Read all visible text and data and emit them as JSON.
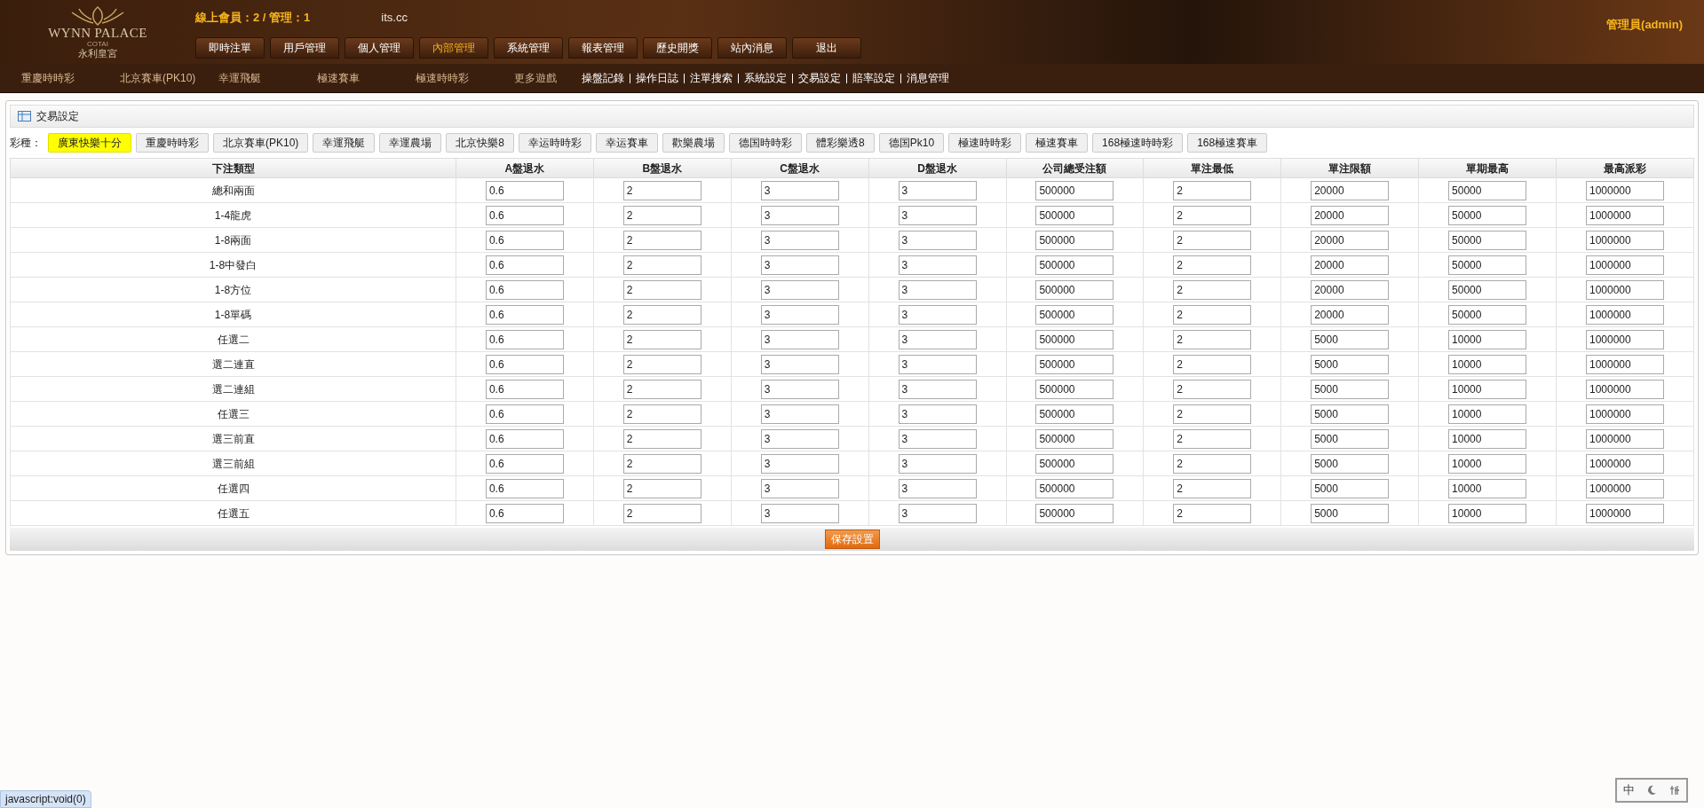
{
  "logo": {
    "name": "WYNN PALACE",
    "sub": "COTAI",
    "chinese": "永利皇宮"
  },
  "online": "線上會員：2 / 管理：1",
  "site": "its.cc",
  "user": "管理員(admin)",
  "menu": [
    {
      "label": "即時注單",
      "selected": false
    },
    {
      "label": "用戶管理",
      "selected": false
    },
    {
      "label": "個人管理",
      "selected": false
    },
    {
      "label": "內部管理",
      "selected": true
    },
    {
      "label": "系統管理",
      "selected": false
    },
    {
      "label": "報表管理",
      "selected": false
    },
    {
      "label": "歷史開獎",
      "selected": false
    },
    {
      "label": "站內消息",
      "selected": false
    },
    {
      "label": "退出",
      "selected": false
    }
  ],
  "games": [
    "重慶時時彩",
    "北京賽車(PK10)",
    "幸運飛艇",
    "極速賽車",
    "極速時時彩",
    "更多遊戲"
  ],
  "links": [
    "操盤記錄",
    "操作日誌",
    "注單搜索",
    "系統設定",
    "交易設定",
    "賠率設定",
    "消息管理"
  ],
  "panel_title": "交易設定",
  "lottery_label": "彩種：",
  "lottery_tabs": [
    {
      "label": "廣東快樂十分",
      "selected": true
    },
    {
      "label": "重慶時時彩",
      "selected": false
    },
    {
      "label": "北京賽車(PK10)",
      "selected": false
    },
    {
      "label": "幸運飛艇",
      "selected": false
    },
    {
      "label": "幸運農場",
      "selected": false
    },
    {
      "label": "北京快樂8",
      "selected": false
    },
    {
      "label": "幸运時時彩",
      "selected": false
    },
    {
      "label": "幸运賽車",
      "selected": false
    },
    {
      "label": "歡樂農場",
      "selected": false
    },
    {
      "label": "德国時時彩",
      "selected": false
    },
    {
      "label": "體彩樂透8",
      "selected": false
    },
    {
      "label": "德国Pk10",
      "selected": false
    },
    {
      "label": "極速時時彩",
      "selected": false
    },
    {
      "label": "極速賽車",
      "selected": false
    },
    {
      "label": "168極速時時彩",
      "selected": false
    },
    {
      "label": "168極速賽車",
      "selected": false
    }
  ],
  "table": {
    "columns": [
      "下注類型",
      "A盤退水",
      "B盤退水",
      "C盤退水",
      "D盤退水",
      "公司總受注額",
      "單注最低",
      "單注限額",
      "單期最高",
      "最高派彩"
    ],
    "rows": [
      {
        "type": "總和兩面",
        "values": [
          "0.6",
          "2",
          "3",
          "3",
          "500000",
          "2",
          "20000",
          "50000",
          "1000000"
        ]
      },
      {
        "type": "1-4龍虎",
        "values": [
          "0.6",
          "2",
          "3",
          "3",
          "500000",
          "2",
          "20000",
          "50000",
          "1000000"
        ]
      },
      {
        "type": "1-8兩面",
        "values": [
          "0.6",
          "2",
          "3",
          "3",
          "500000",
          "2",
          "20000",
          "50000",
          "1000000"
        ]
      },
      {
        "type": "1-8中發白",
        "values": [
          "0.6",
          "2",
          "3",
          "3",
          "500000",
          "2",
          "20000",
          "50000",
          "1000000"
        ]
      },
      {
        "type": "1-8方位",
        "values": [
          "0.6",
          "2",
          "3",
          "3",
          "500000",
          "2",
          "20000",
          "50000",
          "1000000"
        ]
      },
      {
        "type": "1-8單碼",
        "values": [
          "0.6",
          "2",
          "3",
          "3",
          "500000",
          "2",
          "20000",
          "50000",
          "1000000"
        ]
      },
      {
        "type": "任選二",
        "values": [
          "0.6",
          "2",
          "3",
          "3",
          "500000",
          "2",
          "5000",
          "10000",
          "1000000"
        ]
      },
      {
        "type": "選二連直",
        "values": [
          "0.6",
          "2",
          "3",
          "3",
          "500000",
          "2",
          "5000",
          "10000",
          "1000000"
        ]
      },
      {
        "type": "選二連組",
        "values": [
          "0.6",
          "2",
          "3",
          "3",
          "500000",
          "2",
          "5000",
          "10000",
          "1000000"
        ]
      },
      {
        "type": "任選三",
        "values": [
          "0.6",
          "2",
          "3",
          "3",
          "500000",
          "2",
          "5000",
          "10000",
          "1000000"
        ]
      },
      {
        "type": "選三前直",
        "values": [
          "0.6",
          "2",
          "3",
          "3",
          "500000",
          "2",
          "5000",
          "10000",
          "1000000"
        ]
      },
      {
        "type": "選三前組",
        "values": [
          "0.6",
          "2",
          "3",
          "3",
          "500000",
          "2",
          "5000",
          "10000",
          "1000000"
        ]
      },
      {
        "type": "任選四",
        "values": [
          "0.6",
          "2",
          "3",
          "3",
          "500000",
          "2",
          "5000",
          "10000",
          "1000000"
        ]
      },
      {
        "type": "任選五",
        "values": [
          "0.6",
          "2",
          "3",
          "3",
          "500000",
          "2",
          "5000",
          "10000",
          "1000000"
        ]
      }
    ]
  },
  "save_button": "保存設置",
  "status_url": "javascript:void(0)",
  "ime_label": "中"
}
